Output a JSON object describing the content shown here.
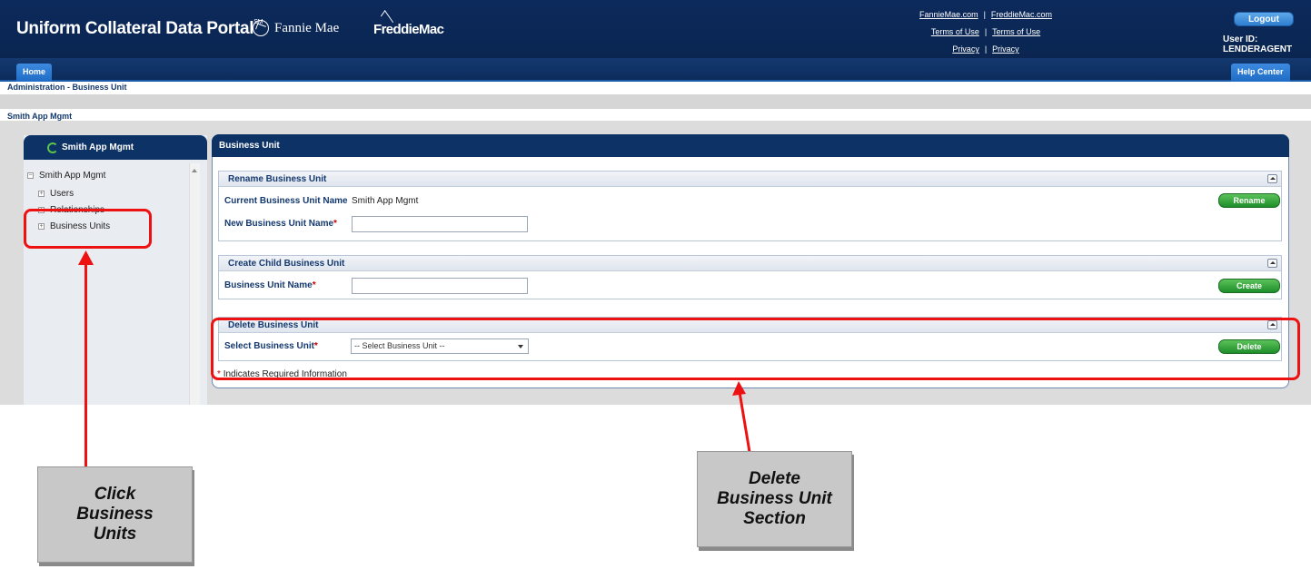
{
  "header": {
    "portal_title": "Uniform Collateral Data Portal",
    "portal_title_mark": "SM",
    "fannie_mae": "Fannie Mae",
    "freddie_mac": "FreddieMac",
    "links": {
      "fanniemae_com": "FannieMae.com",
      "freddiemac_com": "FreddieMac.com",
      "terms_of_use_1": "Terms of Use",
      "terms_of_use_2": "Terms of Use",
      "privacy_1": "Privacy",
      "privacy_2": "Privacy",
      "separator": "|"
    },
    "logout_label": "Logout",
    "user_id": "User ID: LENDERAGENT"
  },
  "nav": {
    "home_label": "Home",
    "help_center_label": "Help Center"
  },
  "breadcrumb": "Administration - Business Unit",
  "subtitle": "Smith App Mgmt",
  "left_panel": {
    "title": "Smith App Mgmt",
    "tree": {
      "root": "Smith App Mgmt",
      "items": [
        "Users",
        "Relationships",
        "Business Units"
      ]
    }
  },
  "main_panel": {
    "title": "Business Unit",
    "rename_section": {
      "title": "Rename Business Unit",
      "current_label": "Current Business Unit Name",
      "current_value": "Smith App Mgmt",
      "new_label": "New Business Unit Name",
      "new_value": "",
      "button_label": "Rename"
    },
    "create_section": {
      "title": "Create Child Business Unit",
      "name_label": "Business Unit Name",
      "name_value": "",
      "button_label": "Create"
    },
    "delete_section": {
      "title": "Delete Business Unit",
      "select_label": "Select Business Unit",
      "select_value": "-- Select Business Unit --",
      "button_label": "Delete"
    },
    "required_note": "Indicates Required Information",
    "required_mark": "*"
  },
  "annotations": {
    "callout_left": [
      "Click",
      "Business",
      "Units"
    ],
    "callout_right": [
      "Delete",
      "Business Unit",
      "Section"
    ]
  },
  "colors": {
    "header_navy": "#0c2a5c",
    "button_green": "#1e8e2a",
    "annotation_red": "#ee1111"
  }
}
